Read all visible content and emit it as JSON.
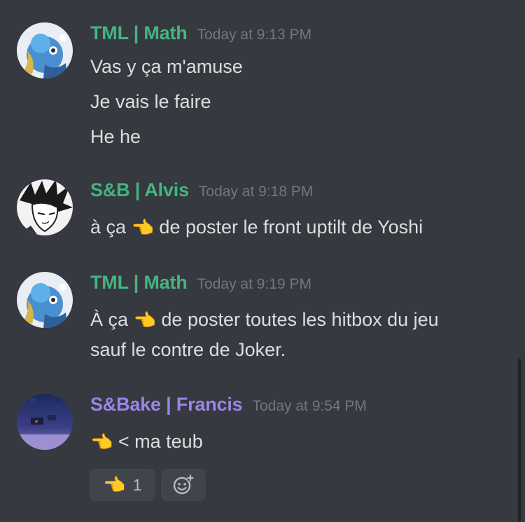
{
  "colors": {
    "background": "#36393f",
    "green_role": "#43b581",
    "purple_role": "#9b84ec",
    "timestamp": "#72767d",
    "text": "#dcddde"
  },
  "messages": [
    {
      "author": "TML | Math",
      "timestamp": "Today at 9:13 PM",
      "avatar": "blue-character-avatar",
      "lines": [
        "Vas y ça m'amuse",
        "Je vais le faire",
        "He he"
      ]
    },
    {
      "author": "S&B | Alvis",
      "timestamp": "Today at 9:18 PM",
      "avatar": "manga-sketch-avatar",
      "lines": [
        {
          "before": "à ça ",
          "emoji": "👈",
          "after": " de poster le front uptilt de Yoshi"
        }
      ]
    },
    {
      "author": "TML | Math",
      "timestamp": "Today at 9:19 PM",
      "avatar": "blue-character-avatar",
      "lines": [
        {
          "before": "À ça ",
          "emoji": "👈",
          "after": " de poster toutes les hitbox du jeu"
        },
        "sauf le contre de Joker."
      ]
    },
    {
      "author": "S&Bake | Francis",
      "timestamp": "Today at 9:54 PM",
      "avatar": "dark-night-avatar",
      "lines": [
        {
          "before": "",
          "emoji": "👈",
          "after": "  < ma teub"
        }
      ],
      "reactions": [
        {
          "emoji": "👈",
          "count": "1"
        }
      ],
      "add_reaction_icon": "add-reaction-icon"
    }
  ]
}
